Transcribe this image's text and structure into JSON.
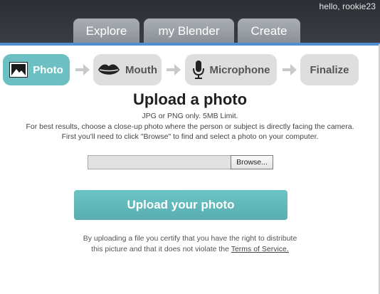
{
  "header": {
    "greeting": "hello, rookie23",
    "tabs": [
      {
        "label": "Explore"
      },
      {
        "label": "my Blender"
      },
      {
        "label": "Create"
      }
    ]
  },
  "steps": [
    {
      "label": "Photo",
      "icon": "photo-icon",
      "active": true
    },
    {
      "label": "Mouth",
      "icon": "lips-icon",
      "active": false
    },
    {
      "label": "Microphone",
      "icon": "microphone-icon",
      "active": false
    },
    {
      "label": "Finalize",
      "icon": "",
      "active": false
    }
  ],
  "main": {
    "title": "Upload a photo",
    "format_note": "JPG or PNG only. 5MB Limit.",
    "tip_line1": "For best results, choose a close-up photo where the person or subject is directly facing the camera.",
    "tip_line2": "First you'll need to click \"Browse\" to find and select a photo on your computer.",
    "file_value": "",
    "browse_label": "Browse...",
    "upload_label": "Upload your photo",
    "disclaimer_line1": "By uploading a file you certify that you have the right to distribute",
    "disclaimer_line2_prefix": "this picture and that it does not violate the ",
    "tos_link": "Terms of Service."
  },
  "colors": {
    "accent": "#6cbfc2",
    "topbar": "#2c2f35",
    "tab": "#9a9ea5",
    "step_inactive": "#dedede",
    "rule": "#4f8fd0"
  }
}
